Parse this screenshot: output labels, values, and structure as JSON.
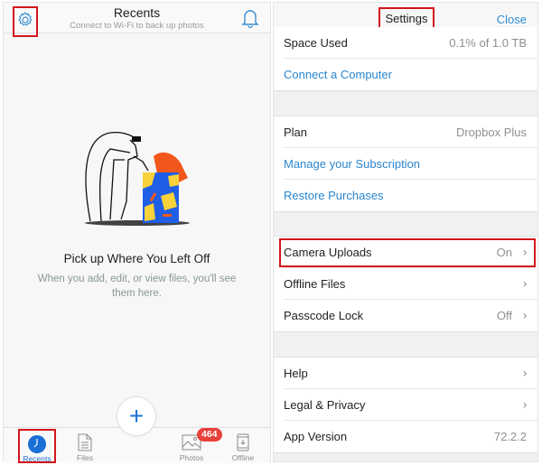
{
  "recents_screen": {
    "title": "Recents",
    "subtitle": "Connect to Wi-Fi to back up photos",
    "settings_icon": "gear-icon",
    "notifications_icon": "bell-icon",
    "empty_state": {
      "title": "Pick up Where You Left Off",
      "description": "When you add, edit, or view files, you'll see them here."
    },
    "tabs": [
      {
        "label": "Recents",
        "icon": "clock-icon",
        "active": true
      },
      {
        "label": "Files",
        "icon": "file-icon"
      },
      {
        "label": "Photos",
        "icon": "photo-icon",
        "badge": "464"
      },
      {
        "label": "Offline",
        "icon": "offline-device-icon"
      }
    ],
    "add_button": "+"
  },
  "settings_screen": {
    "title": "Settings",
    "close_label": "Close",
    "groups": [
      [
        {
          "label": "Space Used",
          "value": "0.1% of 1.0 TB"
        },
        {
          "label": "Connect a Computer",
          "link": true
        }
      ],
      [
        {
          "label": "Plan",
          "value": "Dropbox Plus"
        },
        {
          "label": "Manage your Subscription",
          "link": true
        },
        {
          "label": "Restore Purchases",
          "link": true
        }
      ],
      [
        {
          "label": "Camera Uploads",
          "value": "On",
          "chevron": true
        },
        {
          "label": "Offline Files",
          "chevron": true
        },
        {
          "label": "Passcode Lock",
          "value": "Off",
          "chevron": true
        }
      ],
      [
        {
          "label": "Help",
          "chevron": true
        },
        {
          "label": "Legal & Privacy",
          "chevron": true
        },
        {
          "label": "App Version",
          "value": "72.2.2"
        }
      ]
    ]
  },
  "colors": {
    "accent_blue": "#1a73d6",
    "link_blue": "#2a86cf",
    "highlight_red": "#d4151c",
    "badge_red": "#e8403a"
  }
}
